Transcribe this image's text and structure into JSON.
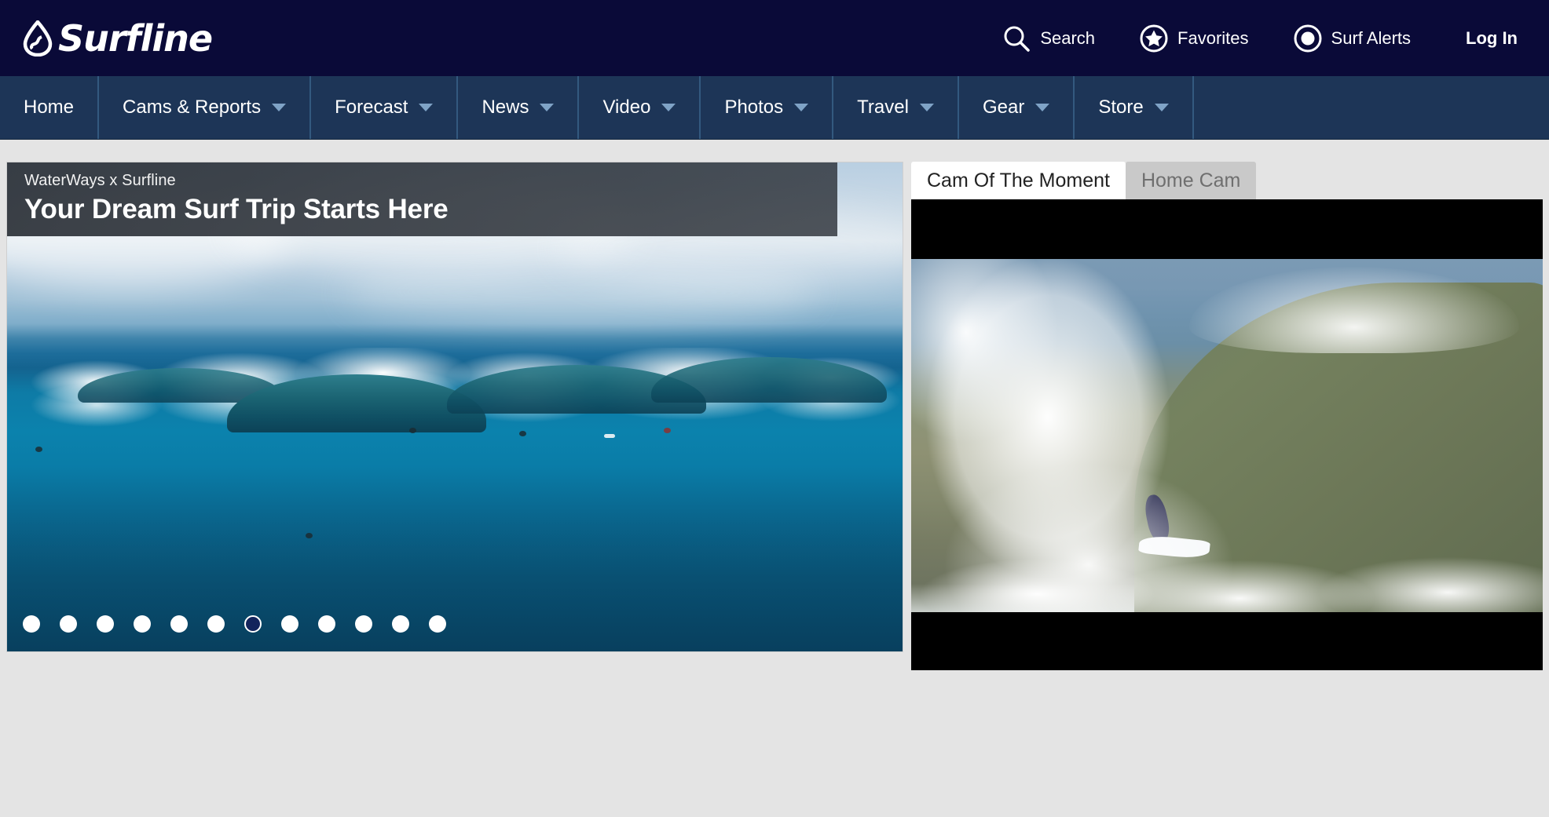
{
  "brand": {
    "name": "Surfline",
    "logo_icon": "water-drop-icon"
  },
  "header": {
    "utility_nav": [
      {
        "label": "Search",
        "icon": "search-icon"
      },
      {
        "label": "Favorites",
        "icon": "star-circle-icon"
      },
      {
        "label": "Surf Alerts",
        "icon": "alert-circle-icon"
      },
      {
        "label": "Log In",
        "icon": null
      }
    ]
  },
  "main_nav": {
    "items": [
      {
        "label": "Home",
        "has_dropdown": false
      },
      {
        "label": "Cams & Reports",
        "has_dropdown": true
      },
      {
        "label": "Forecast",
        "has_dropdown": true
      },
      {
        "label": "News",
        "has_dropdown": true
      },
      {
        "label": "Video",
        "has_dropdown": true
      },
      {
        "label": "Photos",
        "has_dropdown": true
      },
      {
        "label": "Travel",
        "has_dropdown": true
      },
      {
        "label": "Gear",
        "has_dropdown": true
      },
      {
        "label": "Store",
        "has_dropdown": true
      }
    ]
  },
  "hero": {
    "kicker": "WaterWays x Surfline",
    "title": "Your Dream Surf Trip Starts Here",
    "carousel": {
      "total_slides": 12,
      "active_index": 6
    }
  },
  "cam": {
    "tabs": [
      {
        "label": "Cam Of The Moment",
        "active": true
      },
      {
        "label": "Home Cam",
        "active": false
      }
    ]
  },
  "colors": {
    "topbar_bg": "#0a0a38",
    "mainnav_bg": "#1d3557",
    "nav_divider": "#33597f",
    "page_bg": "#e4e4e4",
    "chevron": "#7fa3c6",
    "tab_active_bg": "#ffffff",
    "tab_inactive_bg": "#c9c9c9",
    "dot_active": "#13245c"
  }
}
